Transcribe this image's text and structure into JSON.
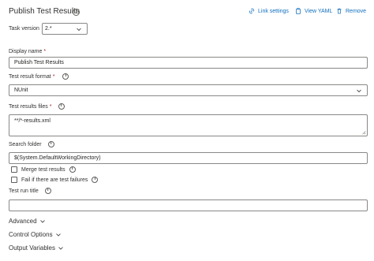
{
  "header": {
    "title": "Publish Test Results",
    "actions": {
      "link_settings": "Link settings",
      "view_yaml": "View YAML",
      "remove": "Remove"
    }
  },
  "task_version": {
    "label": "Task version",
    "value": "2.*"
  },
  "display_name": {
    "label": "Display name",
    "required_mark": "*",
    "value": "Publish Test Results"
  },
  "test_result_format": {
    "label": "Test result format",
    "required_mark": "*",
    "value": "NUnit"
  },
  "test_results_files": {
    "label": "Test results files",
    "required_mark": "*",
    "value": "**/*-results.xml"
  },
  "search_folder": {
    "label": "Search folder",
    "value": "$(System.DefaultWorkingDirectory)"
  },
  "checkboxes": {
    "merge": "Merge test results",
    "fail": "Fail if there are test failures"
  },
  "test_run_title": {
    "label": "Test run title",
    "value": ""
  },
  "sections": {
    "advanced": "Advanced",
    "control_options": "Control Options",
    "output_variables": "Output Variables"
  },
  "colors": {
    "link": "#106ebe",
    "required": "#a4262c",
    "border": "#8a8886"
  }
}
